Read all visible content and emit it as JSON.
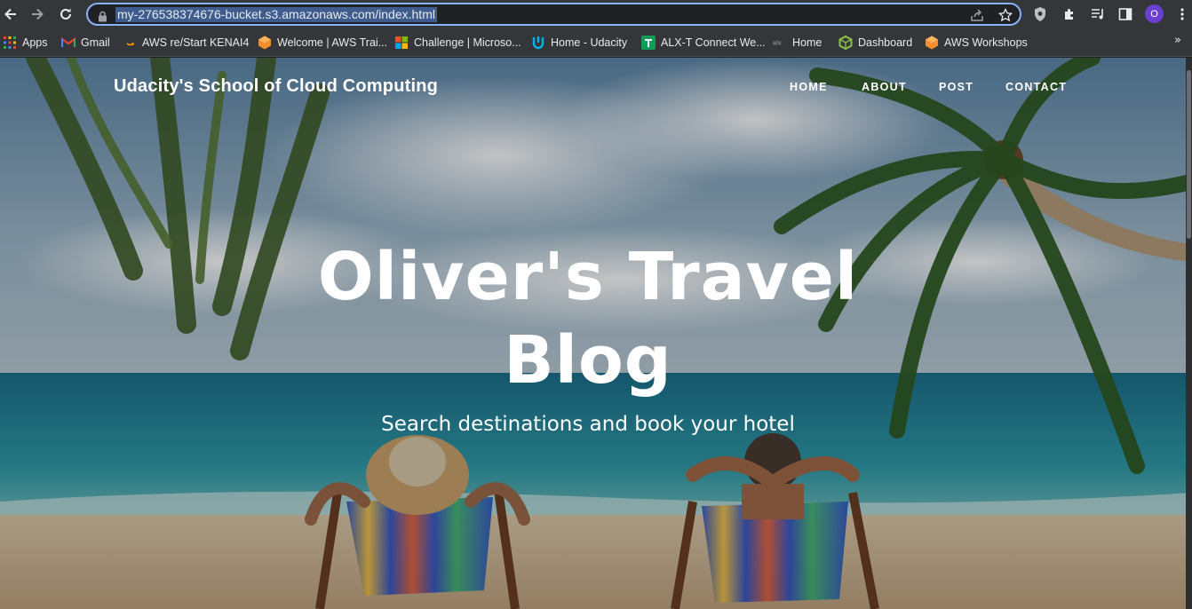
{
  "browser": {
    "url": "my-276538374676-bucket.s3.amazonaws.com/index.html",
    "bookmarks": [
      {
        "label": "Apps",
        "icon": "apps-grid-icon"
      },
      {
        "label": "Gmail",
        "icon": "gmail-icon"
      },
      {
        "label": "AWS re/Start KENAI4",
        "icon": "aws-restart-icon"
      },
      {
        "label": "Welcome | AWS Trai...",
        "icon": "aws-training-icon"
      },
      {
        "label": "Challenge | Microso...",
        "icon": "microsoft-icon"
      },
      {
        "label": "Home - Udacity",
        "icon": "udacity-icon"
      },
      {
        "label": "ALX-T Connect We...",
        "icon": "alx-connect-icon"
      },
      {
        "label": "Home",
        "icon": "alx-home-icon"
      },
      {
        "label": "Dashboard",
        "icon": "dashboard-icon"
      },
      {
        "label": "AWS Workshops",
        "icon": "aws-workshops-icon"
      }
    ],
    "profile_initial": "O",
    "more_bookmarks": "»"
  },
  "site": {
    "brand": "Udacity's School of Cloud Computing",
    "nav": [
      "HOME",
      "ABOUT",
      "POST",
      "CONTACT"
    ]
  },
  "hero": {
    "title_line1": "Oliver's Travel",
    "title_line2": "Blog",
    "subtitle": "Search destinations and book your hotel"
  }
}
